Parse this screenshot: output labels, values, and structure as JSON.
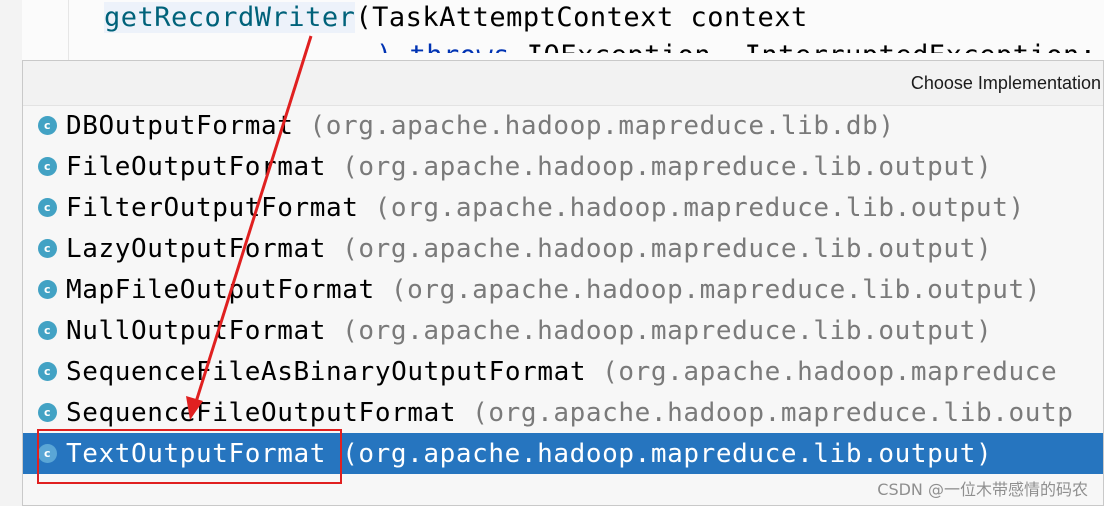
{
  "editor": {
    "method_name": "getRecordWriter",
    "signature_rest": "(TaskAttemptContext context",
    "line2_kw": ") throws",
    "line2_rest": " IOException, InterruptedException;"
  },
  "popup": {
    "title": "Choose Implementation",
    "items": [
      {
        "name": "DBOutputFormat",
        "package": "(org.apache.hadoop.mapreduce.lib.db)",
        "icon": "class-icon"
      },
      {
        "name": "FileOutputFormat",
        "package": "(org.apache.hadoop.mapreduce.lib.output)",
        "icon": "abstract-class-icon"
      },
      {
        "name": "FilterOutputFormat",
        "package": "(org.apache.hadoop.mapreduce.lib.output)",
        "icon": "class-icon"
      },
      {
        "name": "LazyOutputFormat",
        "package": "(org.apache.hadoop.mapreduce.lib.output)",
        "icon": "class-icon"
      },
      {
        "name": "MapFileOutputFormat",
        "package": "(org.apache.hadoop.mapreduce.lib.output)",
        "icon": "class-icon"
      },
      {
        "name": "NullOutputFormat",
        "package": "(org.apache.hadoop.mapreduce.lib.output)",
        "icon": "class-icon"
      },
      {
        "name": "SequenceFileAsBinaryOutputFormat",
        "package": "(org.apache.hadoop.mapreduce",
        "icon": "class-icon"
      },
      {
        "name": "SequenceFileOutputFormat",
        "package": "(org.apache.hadoop.mapreduce.lib.outp",
        "icon": "class-icon"
      },
      {
        "name": "TextOutputFormat",
        "package": "(org.apache.hadoop.mapreduce.lib.output)",
        "icon": "class-icon",
        "selected": true
      }
    ]
  },
  "annotation": {
    "color": "#e02020"
  },
  "watermark": "CSDN @一位木带感情的码农"
}
